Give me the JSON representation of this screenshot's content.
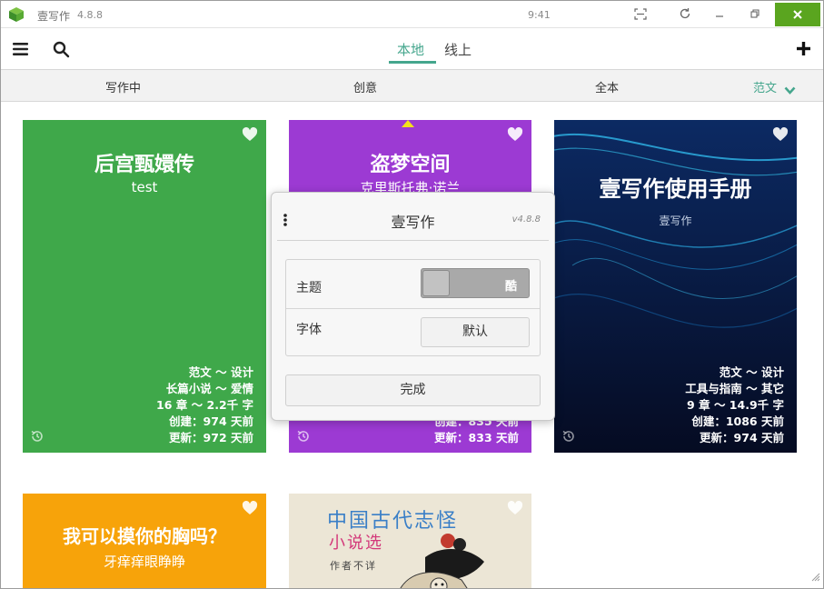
{
  "titlebar": {
    "app_name": "壹写作",
    "version": "4.8.8",
    "clock": "9:41",
    "icons": [
      "app-logo-icon",
      "qr-scan-icon",
      "refresh-icon",
      "minimize-icon",
      "restore-icon",
      "close-icon"
    ],
    "close_color": "#5aa51f"
  },
  "toolbar": {
    "tabs": [
      {
        "label": "本地",
        "active": true
      },
      {
        "label": "线上",
        "active": false
      }
    ],
    "icons": [
      "menu-icon",
      "search-icon",
      "plus-icon"
    ],
    "accent": "#45a68d"
  },
  "categories": [
    {
      "label": "写作中"
    },
    {
      "label": "创意"
    },
    {
      "label": "全本"
    },
    {
      "label": "范文",
      "active": true
    }
  ],
  "cards": [
    {
      "title": "后宫甄嬛传",
      "subtitle": "test",
      "color": "#3fa84a",
      "meta": [
        "范文 ～ 设计",
        "长篇小说 ～ 爱情",
        "16 章 ～ 2.2千 字",
        "创建：974 天前",
        "更新：972 天前"
      ]
    },
    {
      "title": "盗梦空间",
      "subtitle": "克里斯托弗·诺兰",
      "color": "#9c3ad3",
      "meta": [
        "创建：835 天前",
        "更新：833 天前"
      ]
    },
    {
      "title": "壹写作使用手册",
      "subtitle": "壹写作",
      "color": "#0a1e4a",
      "meta": [
        "范文 ～ 设计",
        "工具与指南 ～ 其它",
        "9 章 ～ 14.9千 字",
        "创建：1086 天前",
        "更新：974 天前"
      ]
    },
    {
      "title": "我可以摸你的胸吗？",
      "subtitle": "牙痒痒眼睁睁",
      "color": "#f7a30a"
    },
    {
      "title": "中国古代志怪",
      "title2": "小说选",
      "subtitle": "作者不详",
      "color": "#ece6d6"
    }
  ],
  "dialog": {
    "title": "壹写作",
    "version": "v4.8.8",
    "theme_label": "主题",
    "theme_value": "酷",
    "font_label": "字体",
    "font_value": "默认",
    "done_label": "完成"
  }
}
